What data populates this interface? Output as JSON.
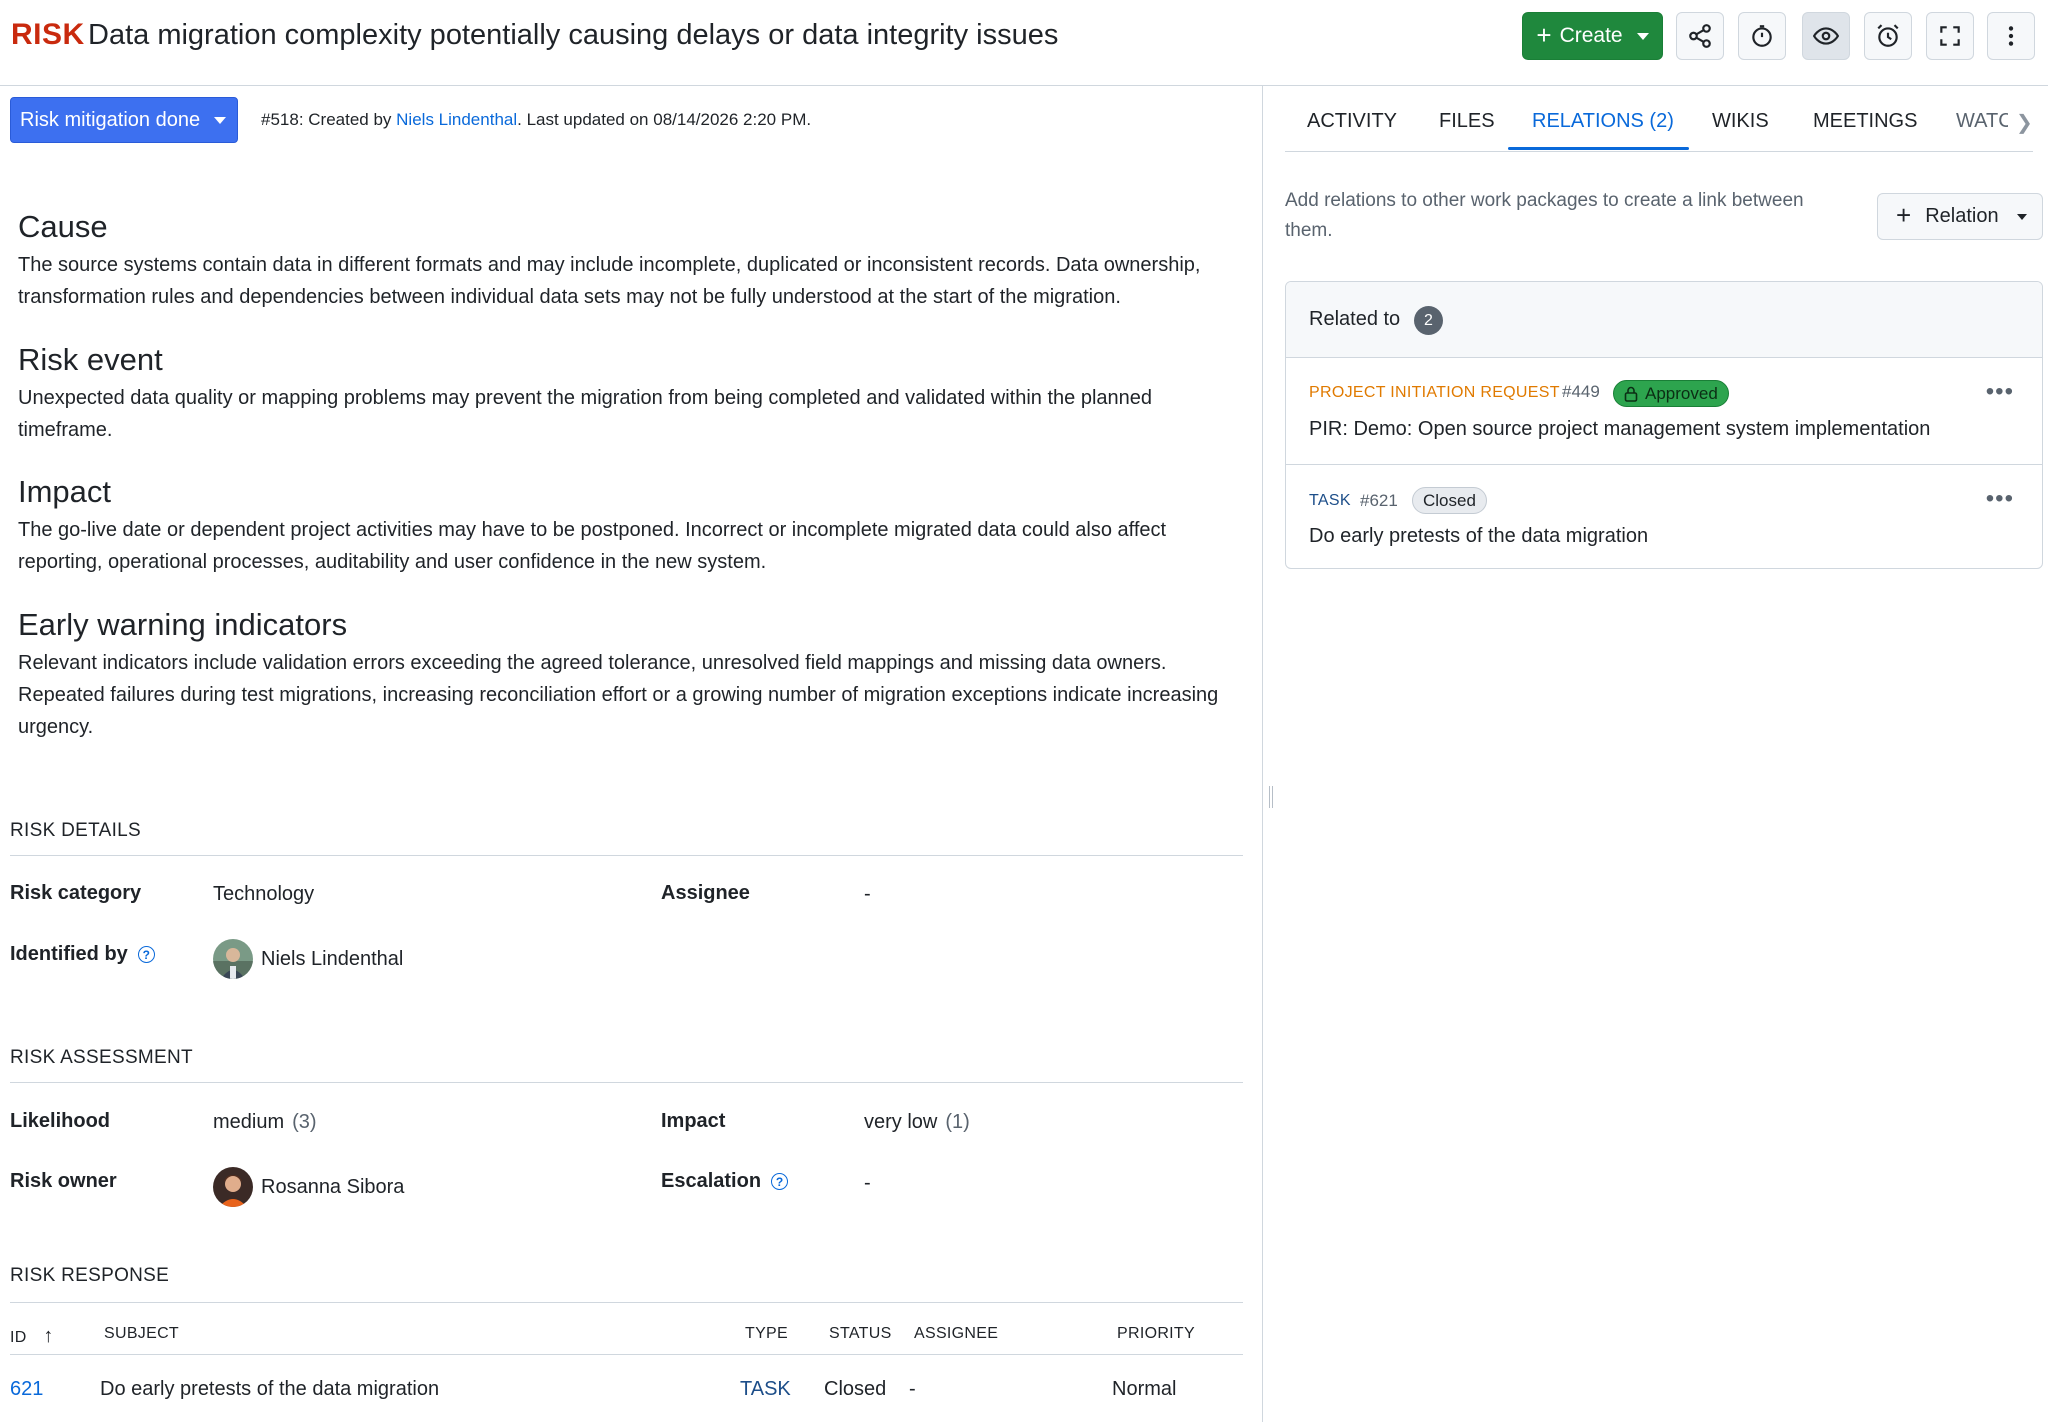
{
  "header": {
    "type_label": "RISK",
    "title": "Data migration complexity potentially causing delays or data integrity issues",
    "create_label": "Create",
    "icons": [
      "share-icon",
      "timer-icon",
      "watch-icon",
      "reminder-icon",
      "fullscreen-icon",
      "more-vertical-icon"
    ]
  },
  "status": {
    "label": "Risk mitigation done",
    "color": "#3d70f0"
  },
  "meta": {
    "prefix": "#518: Created by ",
    "author": "Niels Lindenthal",
    "suffix": ". Last updated on 08/14/2026 2:20 PM."
  },
  "description": [
    {
      "heading": "Cause",
      "text": "The source systems contain data in different formats and may include incomplete, duplicated or inconsistent records. Data ownership, transformation rules and dependencies between individual data sets may not be fully understood at the start of the migration."
    },
    {
      "heading": "Risk event",
      "text": "Unexpected data quality or mapping problems may prevent the migration from being completed and validated within the planned timeframe."
    },
    {
      "heading": "Impact",
      "text": "The go-live date or dependent project activities may have to be postponed. Incorrect or incomplete migrated data could also affect reporting, operational processes, auditability and user confidence in the new system."
    },
    {
      "heading": "Early warning indicators",
      "text": "Relevant indicators include validation errors exceeding the agreed tolerance, unresolved field mappings and missing data owners. Repeated failures during test migrations, increasing reconciliation effort or a growing number of migration exceptions indicate increasing urgency."
    }
  ],
  "risk_details": {
    "title": "RISK DETAILS",
    "category_label": "Risk category",
    "category_value": "Technology",
    "assignee_label": "Assignee",
    "assignee_value": "-",
    "identified_label": "Identified by",
    "identified_value": "Niels Lindenthal"
  },
  "risk_assessment": {
    "title": "RISK ASSESSMENT",
    "likelihood_label": "Likelihood",
    "likelihood_value": "medium",
    "likelihood_score": "(3)",
    "impact_label": "Impact",
    "impact_value": "very low",
    "impact_score": "(1)",
    "owner_label": "Risk owner",
    "owner_value": "Rosanna Sibora",
    "escalation_label": "Escalation",
    "escalation_value": "-"
  },
  "risk_response": {
    "title": "RISK RESPONSE",
    "columns": [
      "ID",
      "SUBJECT",
      "TYPE",
      "STATUS",
      "ASSIGNEE",
      "PRIORITY"
    ],
    "sort_indicator": "↑",
    "rows": [
      {
        "id": "621",
        "subject": "Do early pretests of the data migration",
        "type": "TASK",
        "status": "Closed",
        "assignee": "-",
        "priority": "Normal"
      }
    ]
  },
  "tabs": {
    "items": [
      "ACTIVITY",
      "FILES",
      "RELATIONS (2)",
      "WIKIS",
      "MEETINGS",
      "WATC"
    ],
    "active": "RELATIONS (2)"
  },
  "relations": {
    "hint": "Add relations to other work packages to create a link between them.",
    "add_label": "Relation",
    "group_title": "Related to",
    "group_count": "2",
    "items": [
      {
        "type": "PROJECT INITIATION REQUEST",
        "type_color": "#e07a00",
        "id": "#449",
        "status": "Approved",
        "subject": "PIR: Demo: Open source project management system implementation"
      },
      {
        "type": "TASK",
        "type_color": "#1d4e89",
        "id": "#621",
        "status": "Closed",
        "subject": "Do early pretests of the data migration"
      }
    ]
  },
  "colors": {
    "accent": "#0969da",
    "create_green": "#1f883d",
    "risk_red": "#c92a0e",
    "task_link": "#1d4e89"
  }
}
